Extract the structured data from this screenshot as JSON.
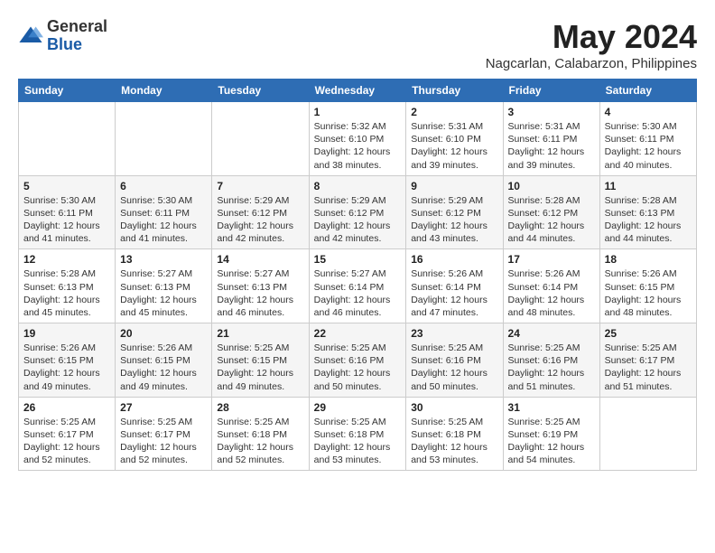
{
  "header": {
    "logo": {
      "line1": "General",
      "line2": "Blue"
    },
    "title": "May 2024",
    "location": "Nagcarlan, Calabarzon, Philippines"
  },
  "weekdays": [
    "Sunday",
    "Monday",
    "Tuesday",
    "Wednesday",
    "Thursday",
    "Friday",
    "Saturday"
  ],
  "weeks": [
    [
      {
        "day": "",
        "sunrise": "",
        "sunset": "",
        "daylight": ""
      },
      {
        "day": "",
        "sunrise": "",
        "sunset": "",
        "daylight": ""
      },
      {
        "day": "",
        "sunrise": "",
        "sunset": "",
        "daylight": ""
      },
      {
        "day": "1",
        "sunrise": "Sunrise: 5:32 AM",
        "sunset": "Sunset: 6:10 PM",
        "daylight": "Daylight: 12 hours and 38 minutes."
      },
      {
        "day": "2",
        "sunrise": "Sunrise: 5:31 AM",
        "sunset": "Sunset: 6:10 PM",
        "daylight": "Daylight: 12 hours and 39 minutes."
      },
      {
        "day": "3",
        "sunrise": "Sunrise: 5:31 AM",
        "sunset": "Sunset: 6:11 PM",
        "daylight": "Daylight: 12 hours and 39 minutes."
      },
      {
        "day": "4",
        "sunrise": "Sunrise: 5:30 AM",
        "sunset": "Sunset: 6:11 PM",
        "daylight": "Daylight: 12 hours and 40 minutes."
      }
    ],
    [
      {
        "day": "5",
        "sunrise": "Sunrise: 5:30 AM",
        "sunset": "Sunset: 6:11 PM",
        "daylight": "Daylight: 12 hours and 41 minutes."
      },
      {
        "day": "6",
        "sunrise": "Sunrise: 5:30 AM",
        "sunset": "Sunset: 6:11 PM",
        "daylight": "Daylight: 12 hours and 41 minutes."
      },
      {
        "day": "7",
        "sunrise": "Sunrise: 5:29 AM",
        "sunset": "Sunset: 6:12 PM",
        "daylight": "Daylight: 12 hours and 42 minutes."
      },
      {
        "day": "8",
        "sunrise": "Sunrise: 5:29 AM",
        "sunset": "Sunset: 6:12 PM",
        "daylight": "Daylight: 12 hours and 42 minutes."
      },
      {
        "day": "9",
        "sunrise": "Sunrise: 5:29 AM",
        "sunset": "Sunset: 6:12 PM",
        "daylight": "Daylight: 12 hours and 43 minutes."
      },
      {
        "day": "10",
        "sunrise": "Sunrise: 5:28 AM",
        "sunset": "Sunset: 6:12 PM",
        "daylight": "Daylight: 12 hours and 44 minutes."
      },
      {
        "day": "11",
        "sunrise": "Sunrise: 5:28 AM",
        "sunset": "Sunset: 6:13 PM",
        "daylight": "Daylight: 12 hours and 44 minutes."
      }
    ],
    [
      {
        "day": "12",
        "sunrise": "Sunrise: 5:28 AM",
        "sunset": "Sunset: 6:13 PM",
        "daylight": "Daylight: 12 hours and 45 minutes."
      },
      {
        "day": "13",
        "sunrise": "Sunrise: 5:27 AM",
        "sunset": "Sunset: 6:13 PM",
        "daylight": "Daylight: 12 hours and 45 minutes."
      },
      {
        "day": "14",
        "sunrise": "Sunrise: 5:27 AM",
        "sunset": "Sunset: 6:13 PM",
        "daylight": "Daylight: 12 hours and 46 minutes."
      },
      {
        "day": "15",
        "sunrise": "Sunrise: 5:27 AM",
        "sunset": "Sunset: 6:14 PM",
        "daylight": "Daylight: 12 hours and 46 minutes."
      },
      {
        "day": "16",
        "sunrise": "Sunrise: 5:26 AM",
        "sunset": "Sunset: 6:14 PM",
        "daylight": "Daylight: 12 hours and 47 minutes."
      },
      {
        "day": "17",
        "sunrise": "Sunrise: 5:26 AM",
        "sunset": "Sunset: 6:14 PM",
        "daylight": "Daylight: 12 hours and 48 minutes."
      },
      {
        "day": "18",
        "sunrise": "Sunrise: 5:26 AM",
        "sunset": "Sunset: 6:15 PM",
        "daylight": "Daylight: 12 hours and 48 minutes."
      }
    ],
    [
      {
        "day": "19",
        "sunrise": "Sunrise: 5:26 AM",
        "sunset": "Sunset: 6:15 PM",
        "daylight": "Daylight: 12 hours and 49 minutes."
      },
      {
        "day": "20",
        "sunrise": "Sunrise: 5:26 AM",
        "sunset": "Sunset: 6:15 PM",
        "daylight": "Daylight: 12 hours and 49 minutes."
      },
      {
        "day": "21",
        "sunrise": "Sunrise: 5:25 AM",
        "sunset": "Sunset: 6:15 PM",
        "daylight": "Daylight: 12 hours and 49 minutes."
      },
      {
        "day": "22",
        "sunrise": "Sunrise: 5:25 AM",
        "sunset": "Sunset: 6:16 PM",
        "daylight": "Daylight: 12 hours and 50 minutes."
      },
      {
        "day": "23",
        "sunrise": "Sunrise: 5:25 AM",
        "sunset": "Sunset: 6:16 PM",
        "daylight": "Daylight: 12 hours and 50 minutes."
      },
      {
        "day": "24",
        "sunrise": "Sunrise: 5:25 AM",
        "sunset": "Sunset: 6:16 PM",
        "daylight": "Daylight: 12 hours and 51 minutes."
      },
      {
        "day": "25",
        "sunrise": "Sunrise: 5:25 AM",
        "sunset": "Sunset: 6:17 PM",
        "daylight": "Daylight: 12 hours and 51 minutes."
      }
    ],
    [
      {
        "day": "26",
        "sunrise": "Sunrise: 5:25 AM",
        "sunset": "Sunset: 6:17 PM",
        "daylight": "Daylight: 12 hours and 52 minutes."
      },
      {
        "day": "27",
        "sunrise": "Sunrise: 5:25 AM",
        "sunset": "Sunset: 6:17 PM",
        "daylight": "Daylight: 12 hours and 52 minutes."
      },
      {
        "day": "28",
        "sunrise": "Sunrise: 5:25 AM",
        "sunset": "Sunset: 6:18 PM",
        "daylight": "Daylight: 12 hours and 52 minutes."
      },
      {
        "day": "29",
        "sunrise": "Sunrise: 5:25 AM",
        "sunset": "Sunset: 6:18 PM",
        "daylight": "Daylight: 12 hours and 53 minutes."
      },
      {
        "day": "30",
        "sunrise": "Sunrise: 5:25 AM",
        "sunset": "Sunset: 6:18 PM",
        "daylight": "Daylight: 12 hours and 53 minutes."
      },
      {
        "day": "31",
        "sunrise": "Sunrise: 5:25 AM",
        "sunset": "Sunset: 6:19 PM",
        "daylight": "Daylight: 12 hours and 54 minutes."
      },
      {
        "day": "",
        "sunrise": "",
        "sunset": "",
        "daylight": ""
      }
    ]
  ]
}
